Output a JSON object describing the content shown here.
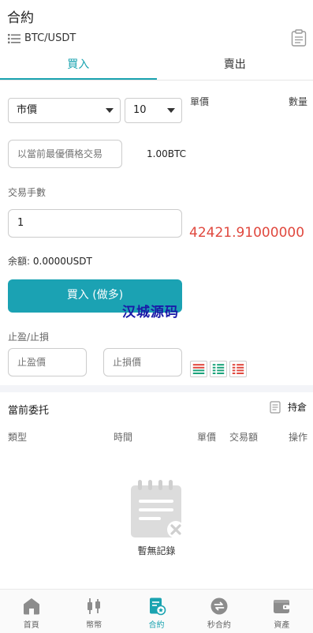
{
  "header": {
    "title": "合約",
    "pair": "BTC/USDT"
  },
  "tabs": [
    {
      "label": "買入"
    },
    {
      "label": "賣出"
    }
  ],
  "order_form": {
    "type_select": "市價",
    "leverage_select": "10",
    "price_header": "單價",
    "qty_header": "數量",
    "market_input_placeholder": "以當前最優價格交易",
    "market_value": "1.00BTC",
    "lots_label": "交易手數",
    "lots_value": "1",
    "current_price": "42421.91000000",
    "balance_label": "余額:",
    "balance_value": "0.0000USDT",
    "buy_button": "買入 (做多)",
    "tp_sl_label": "止盈/止損",
    "tp_placeholder": "止盈價",
    "sl_placeholder": "止損價"
  },
  "watermark": "汉城源码",
  "orders": {
    "title": "當前委托",
    "positions_link": "持倉",
    "columns": [
      "類型",
      "時間",
      "單價",
      "交易額",
      "操作"
    ],
    "empty_text": "暫無記錄"
  },
  "bottom_nav": [
    {
      "label": "首頁",
      "icon": "home-icon"
    },
    {
      "label": "幣幣",
      "icon": "candlestick-icon"
    },
    {
      "label": "合約",
      "icon": "contract-icon"
    },
    {
      "label": "秒合約",
      "icon": "exchange-icon"
    },
    {
      "label": "資產",
      "icon": "wallet-icon"
    }
  ],
  "colors": {
    "accent": "#1ba2b3",
    "price_red": "#e0483e"
  }
}
